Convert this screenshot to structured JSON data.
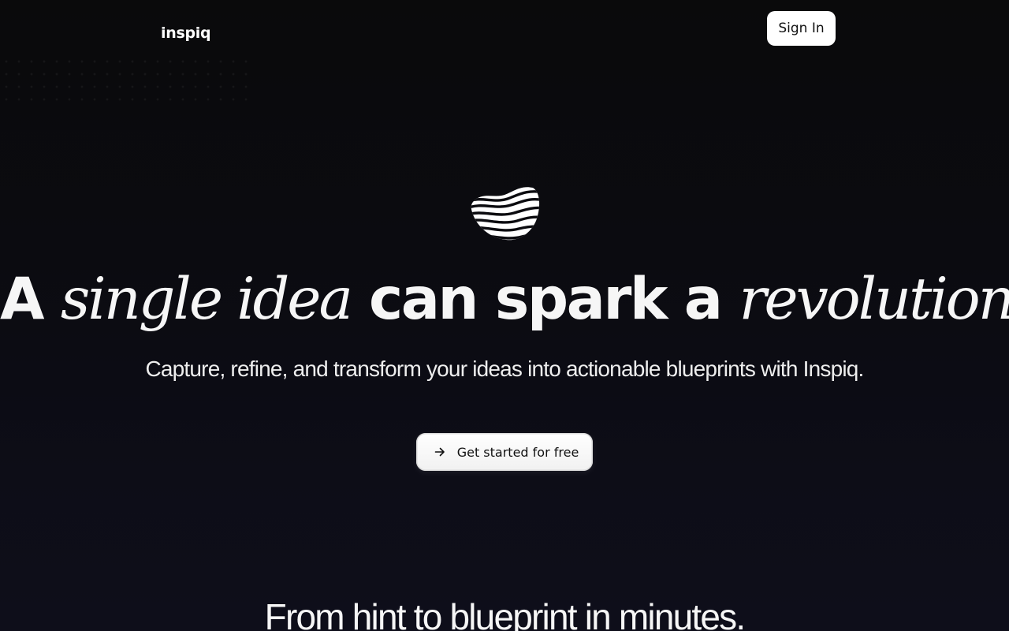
{
  "header": {
    "brand": "inspiq",
    "sign_in_label": "Sign In"
  },
  "hero": {
    "logo_icon": "wave-sphere-icon",
    "headline": {
      "part1": "A ",
      "part2": "single idea",
      "part3": " can spark a ",
      "part4": "revolution."
    },
    "subtitle": "Capture, refine, and transform your ideas into actionable blueprints with Inspiq.",
    "cta_label": "Get started for free",
    "cta_icon": "arrow-right-icon"
  },
  "next_section": {
    "title": "From hint to blueprint in minutes."
  },
  "colors": {
    "background": "#0b0b0f",
    "text": "#ffffff",
    "button_bg": "#ffffff",
    "button_text": "#111111"
  }
}
